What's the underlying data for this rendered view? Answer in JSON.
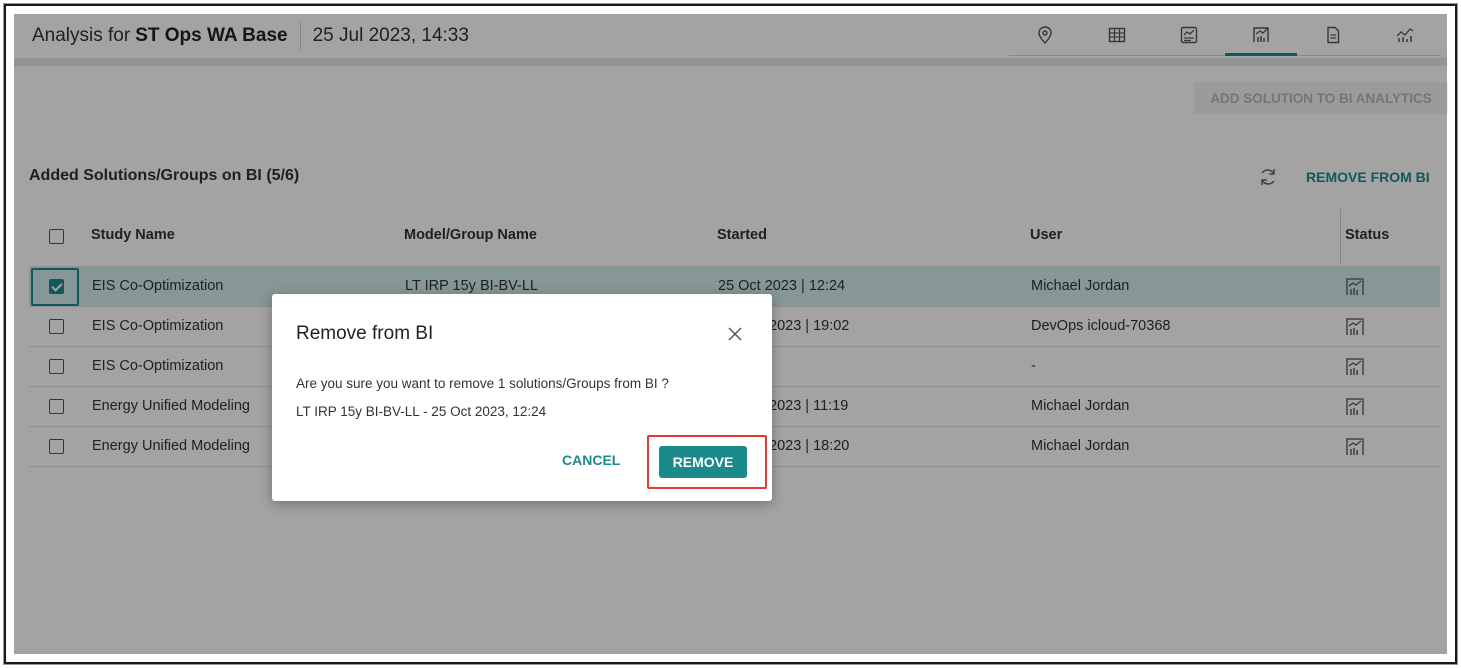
{
  "header": {
    "title_prefix": "Analysis for",
    "title_name": "ST Ops WA Base",
    "date": "25 Jul 2023, 14:33",
    "toolbar_icons": [
      "location-icon",
      "table-icon",
      "chart-settings-icon",
      "bi-chart-icon",
      "document-icon",
      "trend-chart-icon"
    ],
    "active_tool": "bi-chart-icon"
  },
  "actions": {
    "add_solution": "ADD SOLUTION TO BI ANALYTICS",
    "remove_from_bi": "REMOVE FROM BI"
  },
  "section": {
    "title": "Added Solutions/Groups on BI (5/6)"
  },
  "table": {
    "columns": [
      "Study Name",
      "Model/Group Name",
      "Started",
      "User",
      "Status"
    ],
    "rows": [
      {
        "study": "EIS Co-Optimization",
        "model": "LT IRP 15y BI-BV-LL",
        "started": "25 Oct 2023 | 12:24",
        "user": "Michael Jordan",
        "checked": true
      },
      {
        "study": "EIS Co-Optimization",
        "model": "",
        "started": "2023 | 19:02",
        "user": "DevOps icloud-70368",
        "checked": false
      },
      {
        "study": "EIS Co-Optimization",
        "model": "",
        "started": "",
        "user": "-",
        "checked": false
      },
      {
        "study": "Energy Unified Modeling",
        "model": "",
        "started": "2023 | 11:19",
        "user": "Michael Jordan",
        "checked": false
      },
      {
        "study": "Energy Unified Modeling",
        "model": "",
        "started": "2023 | 18:20",
        "user": "Michael Jordan",
        "checked": false
      }
    ]
  },
  "dialog": {
    "title": "Remove from BI",
    "message": "Are you sure you want to remove 1 solutions/Groups from BI ?",
    "detail": "LT IRP 15y BI-BV-LL - 25 Oct 2023, 12:24",
    "cancel": "CANCEL",
    "confirm": "REMOVE"
  },
  "colors": {
    "accent": "#1b8a8c",
    "selected_row": "#d4ecec",
    "highlight": "#e53935"
  }
}
